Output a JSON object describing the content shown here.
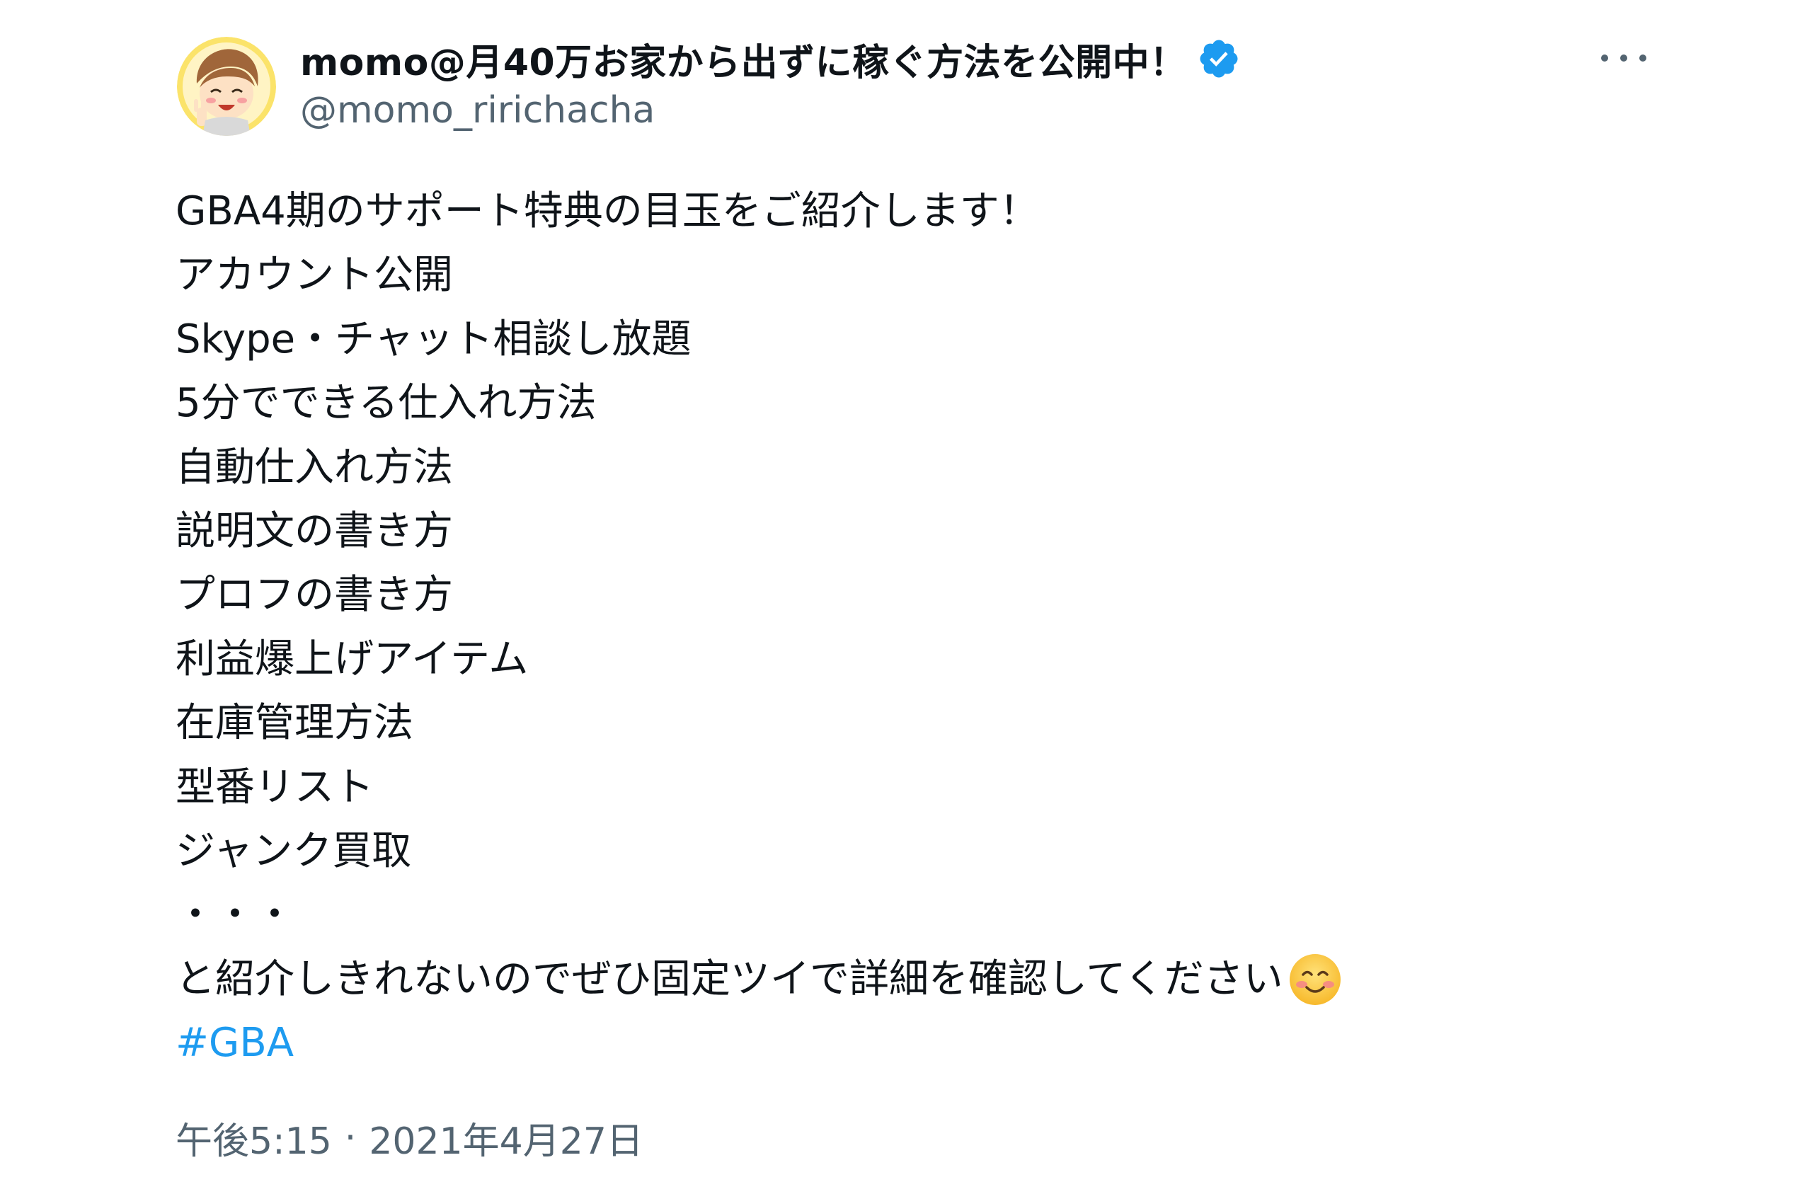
{
  "author": {
    "display_name": "momo@月40万お家から出ずに稼ぐ方法を公開中！",
    "handle": "@momo_ririchacha",
    "verified_icon": "verified-badge-icon",
    "avatar_icon": "avatar-cartoon-icon"
  },
  "more_icon": "more-options-icon",
  "tweet": {
    "lines": [
      "GBA4期のサポート特典の目玉をご紹介します！",
      "アカウント公開",
      "Skype・チャット相談し放題",
      "5分でできる仕入れ方法",
      "自動仕入れ方法",
      "説明文の書き方",
      "プロフの書き方",
      "利益爆上げアイテム",
      "在庫管理方法",
      "型番リスト",
      "ジャンク買取",
      "・・・"
    ],
    "last_line": "と紹介しきれないのでぜひ固定ツイで詳細を確認してください",
    "last_line_emoji": "smiling-face-icon",
    "hashtag": "#GBA"
  },
  "meta": {
    "time": "午後5:15",
    "separator": "·",
    "date": "2021年4月27日"
  },
  "colors": {
    "text": "#0f1419",
    "secondary": "#536471",
    "link": "#1d9bf0",
    "verified": "#1d9bf0"
  }
}
